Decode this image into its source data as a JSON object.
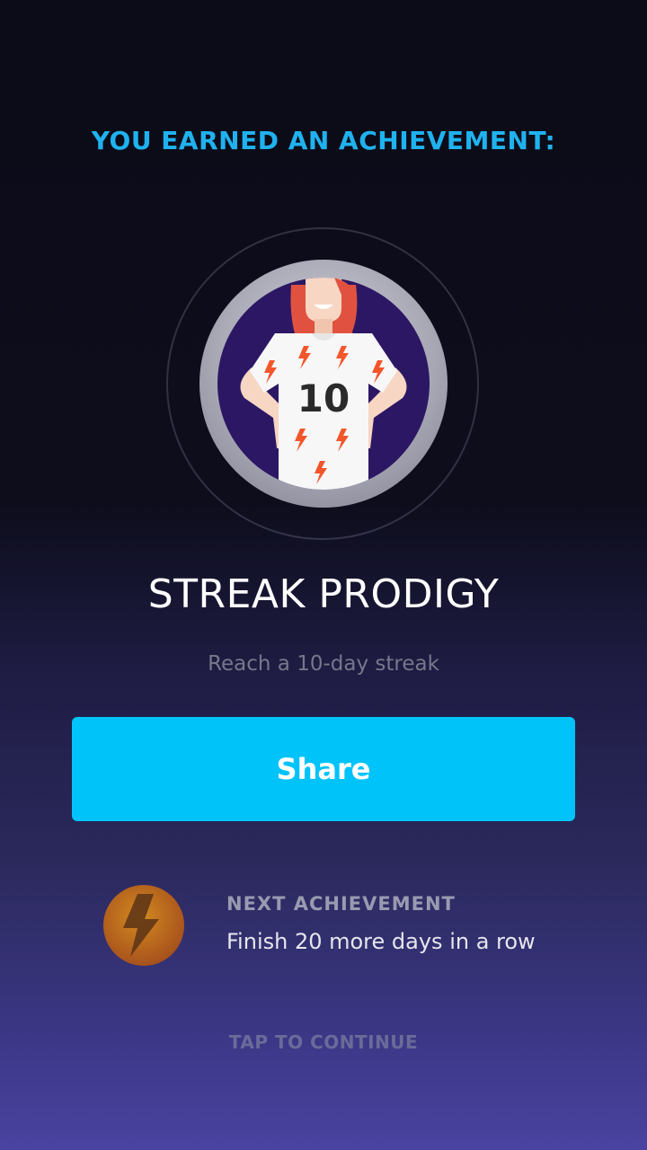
{
  "header": {
    "heading": "YOU EARNED AN ACHIEVEMENT:"
  },
  "badge": {
    "icon": "streak-jersey-badge",
    "jersey_number": "10"
  },
  "achievement": {
    "title": "STREAK PRODIGY",
    "description": "Reach a 10-day streak"
  },
  "actions": {
    "share_label": "Share",
    "continue_label": "TAP TO CONTINUE"
  },
  "next_achievement": {
    "icon": "lightning-badge",
    "label": "NEXT ACHIEVEMENT",
    "description": "Finish 20 more days in a row"
  },
  "colors": {
    "accent": "#1fb2ef",
    "button": "#00c3fa",
    "badge_bg": "#2c1764",
    "lightning": "#f2562b"
  }
}
